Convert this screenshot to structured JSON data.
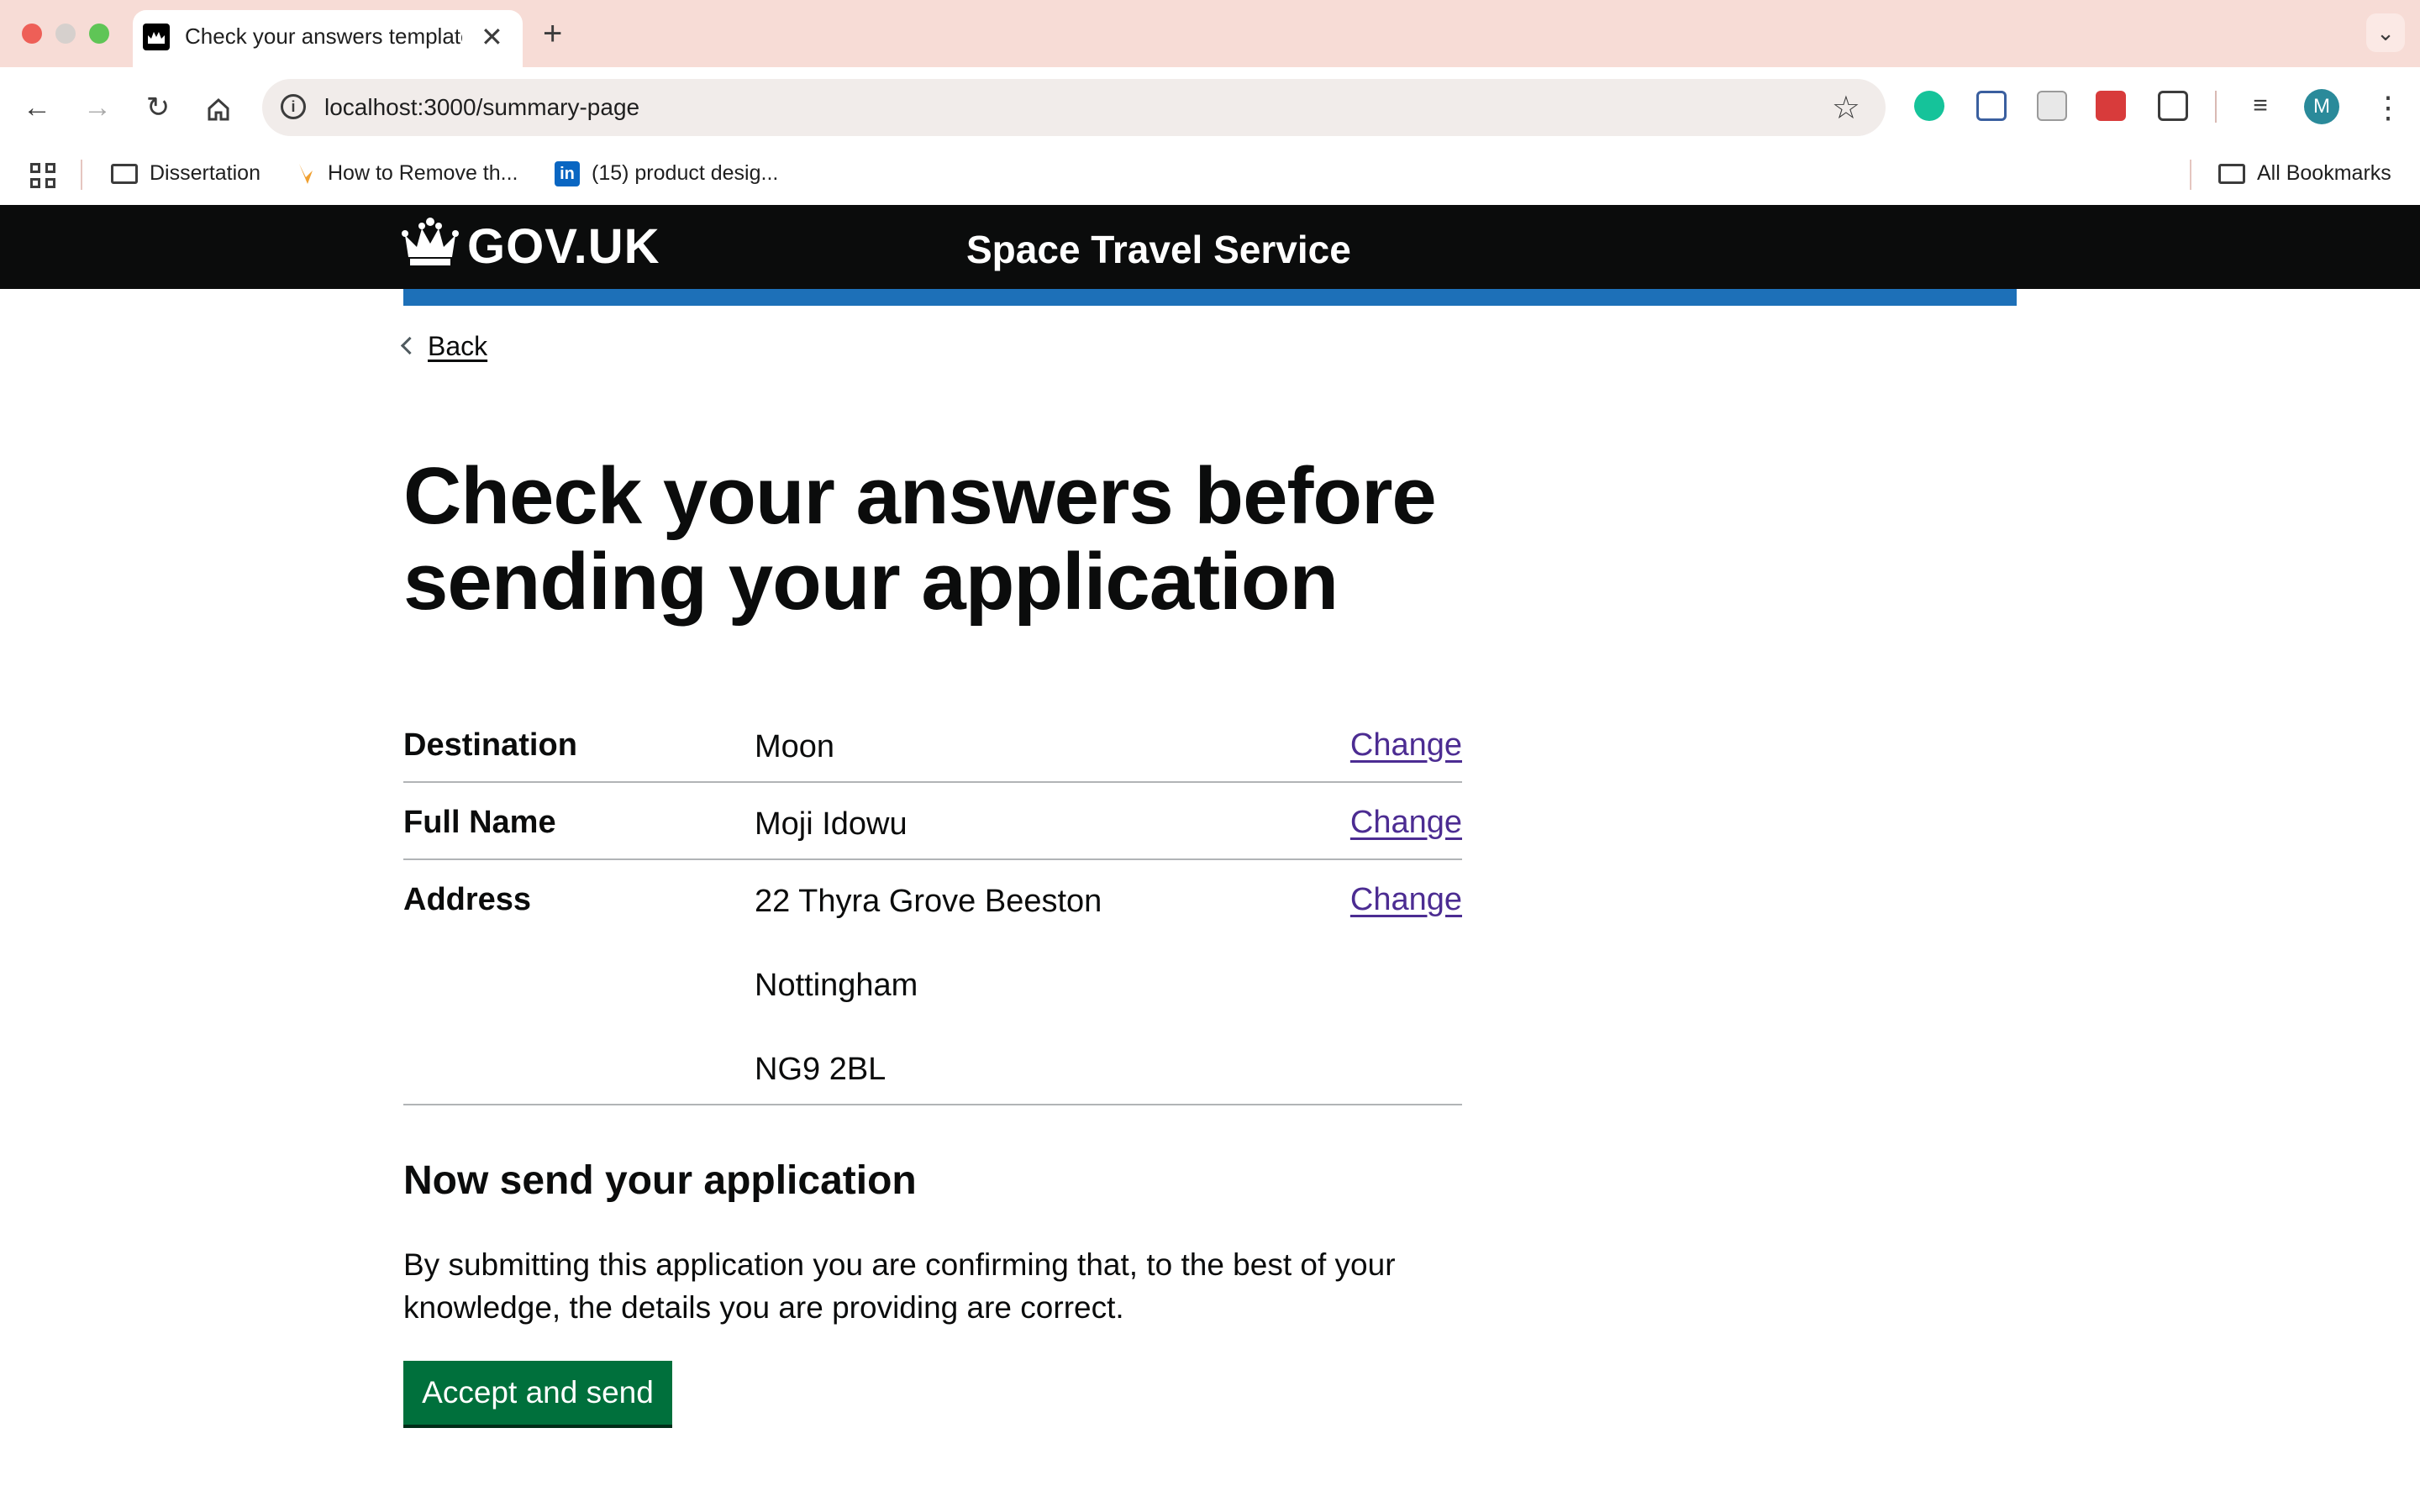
{
  "browser": {
    "tab": {
      "title": "Check your answers template"
    },
    "new_tab_label": "+",
    "address": {
      "url": "localhost:3000/summary-page"
    },
    "bookmarks": [
      {
        "label": "Dissertation",
        "icon": "folder-icon"
      },
      {
        "label": "How to Remove th...",
        "icon": "arrow-bookmark-icon"
      },
      {
        "label": "(15) product desig...",
        "icon": "linkedin-icon"
      }
    ],
    "all_bookmarks_label": "All Bookmarks",
    "profile_initial": "M"
  },
  "header": {
    "logo_text": "GOV.UK",
    "service_name": "Space Travel Service",
    "colors": {
      "header_bg": "#0b0c0c",
      "stripe": "#1d70b8"
    }
  },
  "page": {
    "back_label": "Back",
    "title": "Check your answers before sending your application",
    "summary": [
      {
        "key": "Destination",
        "value": [
          "Moon"
        ],
        "action": "Change"
      },
      {
        "key": "Full Name",
        "value": [
          "Moji Idowu"
        ],
        "action": "Change"
      },
      {
        "key": "Address",
        "value": [
          "22 Thyra Grove Beeston",
          "Nottingham",
          "NG9 2BL"
        ],
        "action": "Change"
      }
    ],
    "send_heading": "Now send your application",
    "declaration": "By submitting this application you are confirming that, to the best of your knowledge, the details you are providing are correct.",
    "submit_label": "Accept and send",
    "colors": {
      "button": "#00703c",
      "link": "#4c2c92"
    }
  }
}
